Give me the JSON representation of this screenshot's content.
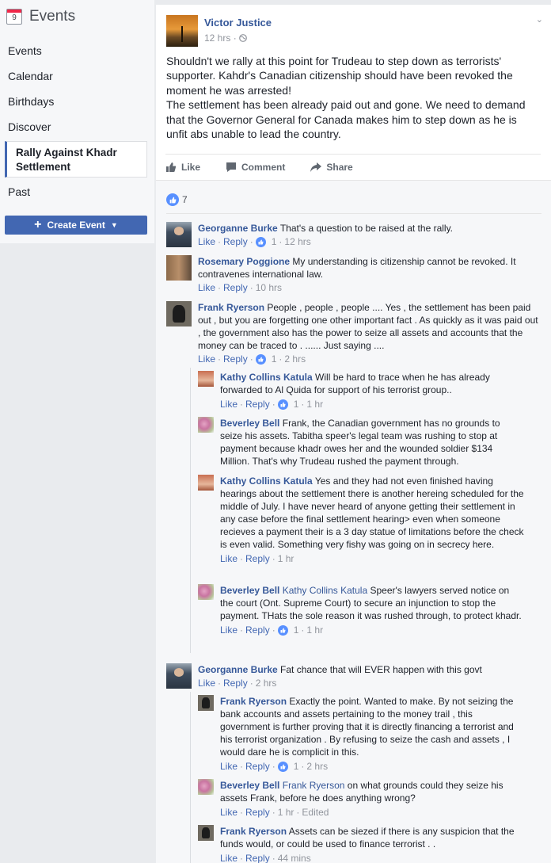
{
  "sidebar": {
    "title": "Events",
    "calendar_day": "9",
    "items": [
      "Events",
      "Calendar",
      "Birthdays",
      "Discover"
    ],
    "active_item": "Rally Against Khadr Settlement",
    "past": "Past",
    "create_button": "Create Event"
  },
  "post": {
    "author": "Victor Justice",
    "time": "12 hrs",
    "text_1": "Shouldn't we rally at this point for Trudeau to step down as terrorists' supporter. Kahdr's Canadian citizenship should have been revoked the moment he was arrested!",
    "text_2": "The settlement has been already paid out and gone. We need to demand that the Governor General for Canada makes him to step down as he is unfit abs unable to lead the country.",
    "actions": {
      "like": "Like",
      "comment": "Comment",
      "share": "Share"
    },
    "like_count": "7"
  },
  "comments": [
    {
      "name": "Georganne Burke",
      "text": "That's a question to be raised at the rally.",
      "like": "Like",
      "reply": "Reply",
      "reactions": "1",
      "time": "12 hrs"
    },
    {
      "name": "Rosemary Poggione",
      "text": "My understanding is citizenship cannot be revoked. It contravenes international law.",
      "like": "Like",
      "reply": "Reply",
      "time": "10 hrs"
    },
    {
      "name": "Frank Ryerson",
      "text": "People , people , people .... Yes , the settlement has been paid out , but you are forgetting one other important fact . As quickly as it was paid out , the government also has the power to seize all assets and accounts that the money can be traced to . ...... Just saying ....",
      "like": "Like",
      "reply": "Reply",
      "reactions": "1",
      "time": "2 hrs",
      "replies": [
        {
          "name": "Kathy Collins Katula",
          "text": "Will be hard to trace when he has already forwarded to Al Quida for support of his terrorist group..",
          "like": "Like",
          "reply": "Reply",
          "reactions": "1",
          "time": "1 hr"
        },
        {
          "name": "Beverley Bell",
          "text": "Frank, the Canadian government has no grounds to seize his assets. Tabitha speer's legal team was rushing to stop at payment because khadr owes her and the wounded soldier $134 Million. That's why Trudeau rushed the payment through."
        },
        {
          "name": "Kathy Collins Katula",
          "text": "Yes and they had not even finished having hearings about the settlement there is another hereing scheduled for the middle of July. I have never heard of anyone getting their settlement in any case before the final settlement hearing> even when someone recieves a payment their is a 3 day statue of limitations before the check is even valid. Something very fishy was going on in secrecy here.",
          "like": "Like",
          "reply": "Reply",
          "time": "1 hr"
        },
        {
          "name": "Beverley Bell",
          "mention": "Kathy Collins Katula",
          "text": "Speer's lawyers served notice on the court (Ont. Supreme Court) to secure an injunction to stop the payment. THats the sole reason it was rushed through, to protect khadr.",
          "like": "Like",
          "reply": "Reply",
          "reactions": "1",
          "time": "1 hr"
        }
      ]
    },
    {
      "name": "Georganne Burke",
      "text": "Fat chance that will EVER happen with this govt",
      "like": "Like",
      "reply": "Reply",
      "time": "2 hrs",
      "replies": [
        {
          "name": "Frank Ryerson",
          "text": "Exactly the point. Wanted to make. By not seizing the bank accounts and assets pertaining to the money trail , this government is further proving that it is directly financing a terrorist and his terrorist organization . By refusing to seize the cash and assets , I would dare he is complicit in this.",
          "like": "Like",
          "reply": "Reply",
          "reactions": "1",
          "time": "2 hrs"
        },
        {
          "name": "Beverley Bell",
          "mention": "Frank Ryerson",
          "text": "on what grounds could they seize his assets Frank, before he does anything wrong?",
          "like": "Like",
          "reply": "Reply",
          "time": "1 hr",
          "edited": "Edited"
        },
        {
          "name": "Frank Ryerson",
          "text": "Assets can be siezed if there is any suspicion that the funds would, or could be used to finance terrorist . .",
          "like": "Like",
          "reply": "Reply",
          "time": "44 mins"
        }
      ]
    }
  ]
}
